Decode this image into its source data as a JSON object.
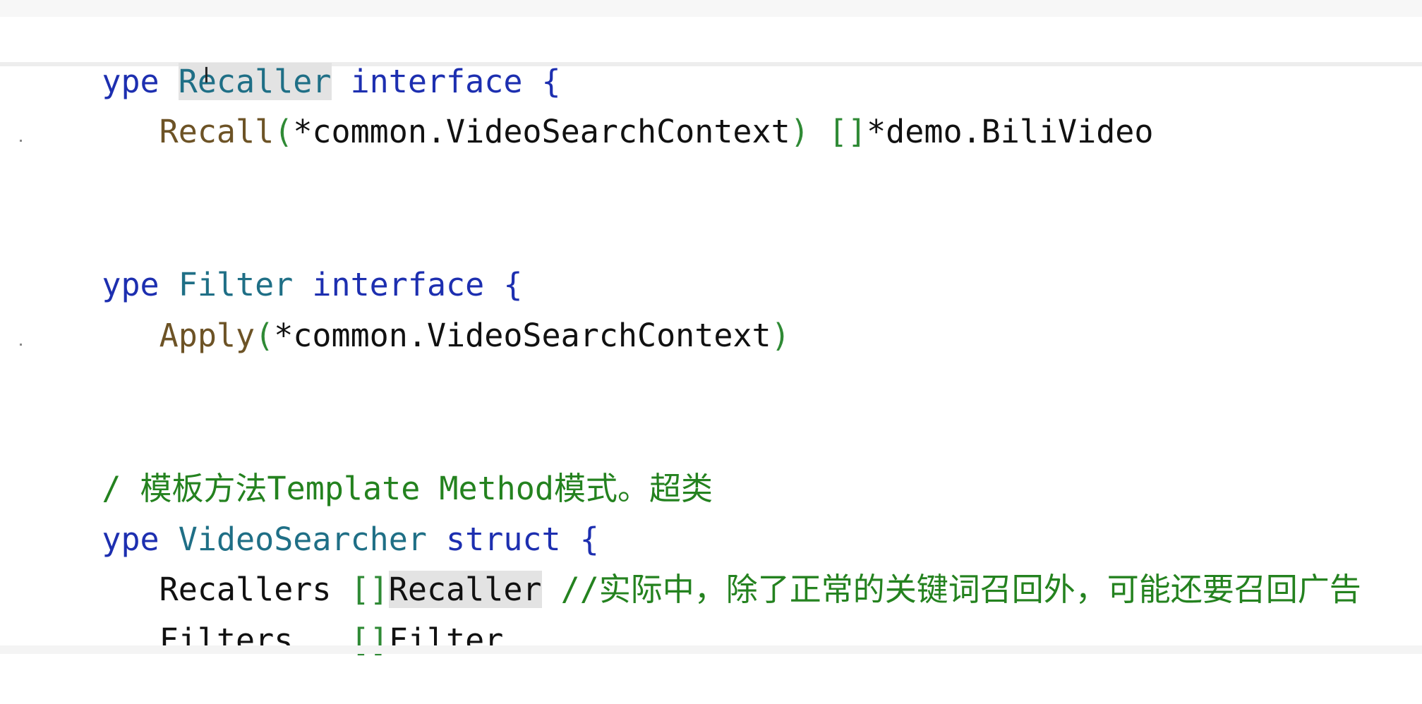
{
  "editor": {
    "lines": [
      {
        "tokens": [
          {
            "text": "ype ",
            "kind": "kw"
          },
          {
            "text": "Recaller",
            "kind": "tn",
            "selected": true
          },
          {
            "text": " interface ",
            "kind": "kw"
          },
          {
            "text": "{",
            "kind": "kw"
          }
        ]
      },
      {
        "tokens": [
          {
            "text": "   ",
            "kind": "plain"
          },
          {
            "text": "Recall",
            "kind": "fn"
          },
          {
            "text": "(",
            "kind": "br"
          },
          {
            "text": "*common.VideoSearchContext",
            "kind": "plain"
          },
          {
            "text": ")",
            "kind": "br"
          },
          {
            "text": " ",
            "kind": "plain"
          },
          {
            "text": "[]",
            "kind": "br"
          },
          {
            "text": "*demo.BiliVideo",
            "kind": "plain"
          }
        ]
      },
      {
        "tokens": [
          {
            "text": "ype ",
            "kind": "kw"
          },
          {
            "text": "Filter",
            "kind": "tn"
          },
          {
            "text": " interface ",
            "kind": "kw"
          },
          {
            "text": "{",
            "kind": "kw"
          }
        ]
      },
      {
        "tokens": [
          {
            "text": "   ",
            "kind": "plain"
          },
          {
            "text": "Apply",
            "kind": "fn"
          },
          {
            "text": "(",
            "kind": "br"
          },
          {
            "text": "*common.VideoSearchContext",
            "kind": "plain"
          },
          {
            "text": ")",
            "kind": "br"
          }
        ]
      },
      {
        "tokens": [
          {
            "text": "/ 模板方法Template Method模式。超类",
            "kind": "cm"
          }
        ]
      },
      {
        "tokens": [
          {
            "text": "ype ",
            "kind": "kw"
          },
          {
            "text": "VideoSearcher",
            "kind": "tn"
          },
          {
            "text": " struct ",
            "kind": "kw"
          },
          {
            "text": "{",
            "kind": "kw"
          }
        ]
      },
      {
        "tokens": [
          {
            "text": "   Recallers ",
            "kind": "plain"
          },
          {
            "text": "[]",
            "kind": "br"
          },
          {
            "text": "Recaller",
            "kind": "plain",
            "selected": true
          },
          {
            "text": " //实际中，除了正常的关键词召回外，可能还要召回广告",
            "kind": "cm"
          }
        ]
      },
      {
        "tokens": [
          {
            "text": "   Filters   ",
            "kind": "plain"
          },
          {
            "text": "[]",
            "kind": "br"
          },
          {
            "text": "Filter",
            "kind": "plain"
          }
        ]
      }
    ]
  },
  "cursor": {
    "icon": "text-cursor-icon",
    "glyph": "I"
  },
  "colors": {
    "keyword": "#1d2fb0",
    "type_name": "#1f6f86",
    "function_name": "#6d5326",
    "bracket": "#2f8a35",
    "comment": "#24821f",
    "selection": "#e3e3e3"
  }
}
